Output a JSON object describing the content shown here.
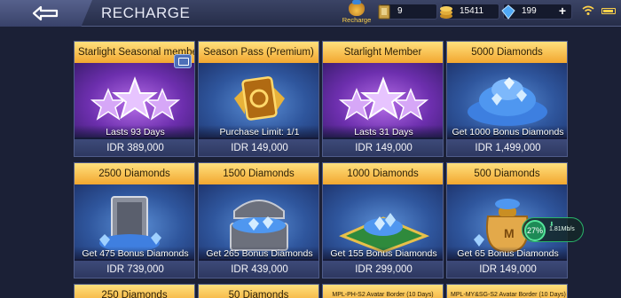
{
  "header": {
    "title": "RECHARGE",
    "recharge_tab_label": "Recharge",
    "currencies": [
      {
        "name": "tickets",
        "icon": "ticket-icon",
        "value": "9"
      },
      {
        "name": "battle-points",
        "icon": "coin-stack-icon",
        "value": "15411"
      },
      {
        "name": "diamonds",
        "icon": "diamond-icon",
        "value": "199"
      }
    ]
  },
  "items": [
    {
      "title": "Starlight Seasonal member",
      "caption": "Lasts 93 Days",
      "price": "IDR 389,000",
      "art": "three-stars-icon"
    },
    {
      "title": "Season Pass (Premium)",
      "caption": "Purchase Limit: 1/1",
      "price": "IDR 149,000",
      "art": "golden-badge-icon"
    },
    {
      "title": "Starlight Member",
      "caption": "Lasts 31 Days",
      "price": "IDR 149,000",
      "art": "three-stars-icon"
    },
    {
      "title": "5000 Diamonds",
      "caption": "Get 1000 Bonus Diamonds",
      "price": "IDR 1,499,000",
      "art": "diamond-pile-icon"
    },
    {
      "title": "2500 Diamonds",
      "caption": "Get 475 Bonus Diamonds",
      "price": "IDR 739,000",
      "art": "diamond-safe-icon"
    },
    {
      "title": "1500 Diamonds",
      "caption": "Get 265 Bonus Diamonds",
      "price": "IDR 439,000",
      "art": "diamond-chest-icon"
    },
    {
      "title": "1000 Diamonds",
      "caption": "Get 155 Bonus Diamonds",
      "price": "IDR 299,000",
      "art": "diamond-carpet-icon"
    },
    {
      "title": "500 Diamonds",
      "caption": "Get 65 Bonus Diamonds",
      "price": "IDR 149,000",
      "art": "diamond-bag-icon"
    },
    {
      "title": "250 Diamonds",
      "art": "diamond-icon"
    },
    {
      "title": "50 Diamonds",
      "art": "diamond-icon"
    },
    {
      "title": "MPL-PH-S2 Avatar Border (10 Days)",
      "art": "avatar-border-icon"
    },
    {
      "title": "MPL-MY&SG-S2 Avatar Border (10 Days)",
      "art": "avatar-border-icon"
    }
  ],
  "overlay": {
    "download_percent": "27%",
    "download_rate": "1.81Mb/s"
  },
  "colors": {
    "header_gold": "#f2a730",
    "purple_bg": "#6d2fae",
    "blue_bg": "#2f569d",
    "page_bg": "#1b2036"
  }
}
